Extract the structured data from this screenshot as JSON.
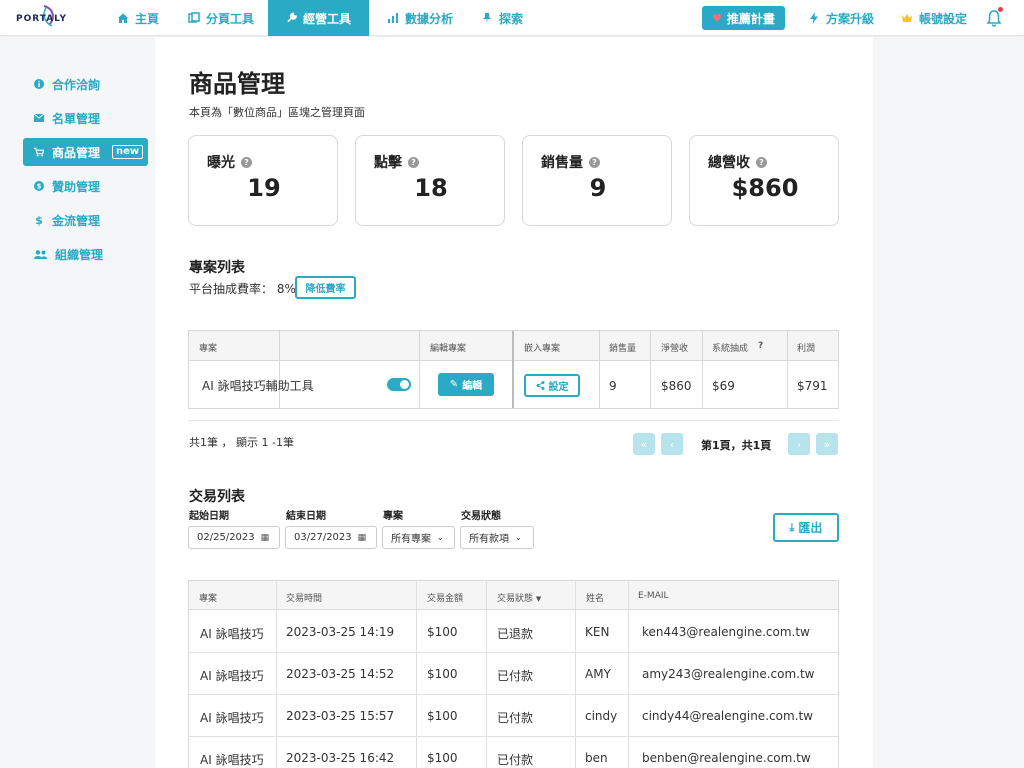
{
  "brand": {
    "logo_text": "PORTALY",
    "accent": "#2aaac4"
  },
  "topnav": {
    "items": [
      {
        "label": "主頁",
        "icon": "home-icon"
      },
      {
        "label": "分頁工具",
        "icon": "pages-icon"
      },
      {
        "label": "經營工具",
        "icon": "wrench-icon",
        "active": true
      },
      {
        "label": "數據分析",
        "icon": "bar-chart-icon"
      },
      {
        "label": "探索",
        "icon": "pin-icon"
      }
    ],
    "promo_label": "推薦計畫",
    "upgrade_label": "方案升級",
    "account_label": "帳號設定"
  },
  "sidebar": {
    "items": [
      {
        "label": "合作洽詢",
        "icon": "info-icon"
      },
      {
        "label": "名單管理",
        "icon": "mail-icon"
      },
      {
        "label": "商品管理",
        "icon": "cart-icon",
        "active": true,
        "badge": "new"
      },
      {
        "label": "贊助管理",
        "icon": "coin-icon"
      },
      {
        "label": "金流管理",
        "icon": "dollar-icon"
      },
      {
        "label": "組織管理",
        "icon": "people-icon"
      }
    ]
  },
  "page": {
    "title": "商品管理",
    "subtitle": "本頁為「數位商品」區塊之管理頁面"
  },
  "stats": [
    {
      "label": "曝光",
      "value": "19"
    },
    {
      "label": "點擊",
      "value": "18"
    },
    {
      "label": "銷售量",
      "value": "9"
    },
    {
      "label": "總營收",
      "value": "$860"
    }
  ],
  "projects": {
    "title": "專案列表",
    "fee_label": "平台抽成費率：",
    "fee_value": "8%",
    "lower_fee_label": "降低費率",
    "headers": [
      "專案",
      "編輯專案",
      "嵌入專案",
      "銷售量",
      "淨營收",
      "系統抽成",
      "利潤"
    ],
    "header_help": "?",
    "row": {
      "name": "AI 詠唱技巧輔助工具",
      "enabled": true,
      "edit_label": "編輯",
      "embed_label": "設定",
      "sales": "9",
      "net": "$860",
      "commission": "$69",
      "profit": "$791"
    },
    "count_text": "共1筆 ， 顯示 1 -1筆",
    "page_text": "第1頁，共1頁",
    "pager": [
      "«",
      "‹",
      "›",
      "»"
    ]
  },
  "transactions": {
    "title": "交易列表",
    "filters": {
      "start_label": "起始日期",
      "start_value": "02/25/2023",
      "end_label": "結束日期",
      "end_value": "03/27/2023",
      "project_label": "專案",
      "project_value": "所有專案",
      "status_label": "交易狀態",
      "status_value": "所有款項"
    },
    "export_label": "匯出",
    "headers": [
      "專案",
      "交易時間",
      "交易金額",
      "交易狀態",
      "姓名",
      "E-MAIL"
    ],
    "rows": [
      {
        "project": "AI 詠唱技巧",
        "time": "2023-03-25 14:19",
        "amount": "$100",
        "status": "已退款",
        "name": "KEN",
        "email": "ken443@realengine.com.tw"
      },
      {
        "project": "AI 詠唱技巧",
        "time": "2023-03-25 14:52",
        "amount": "$100",
        "status": "已付款",
        "name": "AMY",
        "email": "amy243@realengine.com.tw"
      },
      {
        "project": "AI 詠唱技巧",
        "time": "2023-03-25 15:57",
        "amount": "$100",
        "status": "已付款",
        "name": "cindy",
        "email": "cindy44@realengine.com.tw"
      },
      {
        "project": "AI 詠唱技巧",
        "time": "2023-03-25 16:42",
        "amount": "$100",
        "status": "已付款",
        "name": "ben",
        "email": "benben@realengine.com.tw"
      }
    ]
  }
}
